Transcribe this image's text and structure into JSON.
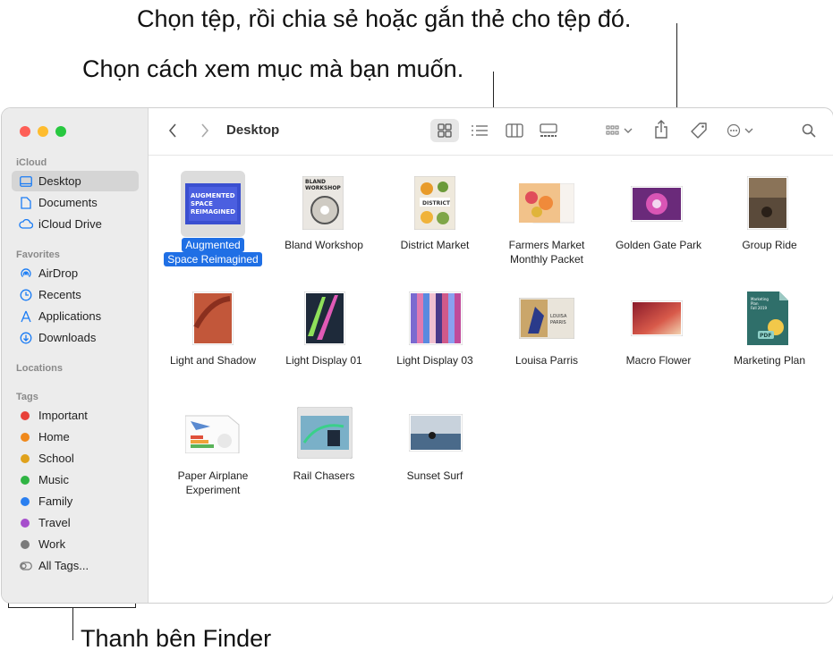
{
  "callouts": {
    "top_share_tag": "Chọn tệp, rồi chia sẻ hoặc gắn thẻ cho tệp đó.",
    "top_view": "Chọn cách xem mục mà bạn muốn.",
    "bottom_sidebar": "Thanh bên Finder"
  },
  "window": {
    "title": "Desktop"
  },
  "sidebar": {
    "sections": {
      "icloud": "iCloud",
      "favorites": "Favorites",
      "locations": "Locations",
      "tags": "Tags"
    },
    "icloud_items": [
      {
        "label": "Desktop",
        "icon": "desktop-icon"
      },
      {
        "label": "Documents",
        "icon": "document-icon"
      },
      {
        "label": "iCloud Drive",
        "icon": "cloud-icon"
      }
    ],
    "favorite_items": [
      {
        "label": "AirDrop",
        "icon": "airdrop-icon"
      },
      {
        "label": "Recents",
        "icon": "clock-icon"
      },
      {
        "label": "Applications",
        "icon": "applications-icon"
      },
      {
        "label": "Downloads",
        "icon": "download-icon"
      }
    ],
    "tag_items": [
      {
        "label": "Important",
        "color": "#e8413a"
      },
      {
        "label": "Home",
        "color": "#f0891b"
      },
      {
        "label": "School",
        "color": "#e0a21c"
      },
      {
        "label": "Music",
        "color": "#2fb443"
      },
      {
        "label": "Family",
        "color": "#2a7ff0"
      },
      {
        "label": "Travel",
        "color": "#a64fcc"
      },
      {
        "label": "Work",
        "color": "#7b7b7b"
      }
    ],
    "all_tags": "All Tags..."
  },
  "files": [
    {
      "line1": "Augmented",
      "line2": "Space Reimagined",
      "selected": true
    },
    {
      "line1": "Bland Workshop",
      "line2": ""
    },
    {
      "line1": "District Market",
      "line2": ""
    },
    {
      "line1": "Farmers Market",
      "line2": "Monthly Packet"
    },
    {
      "line1": "Golden Gate Park",
      "line2": ""
    },
    {
      "line1": "Group Ride",
      "line2": ""
    },
    {
      "line1": "Light and Shadow",
      "line2": ""
    },
    {
      "line1": "Light Display 01",
      "line2": ""
    },
    {
      "line1": "Light Display 03",
      "line2": ""
    },
    {
      "line1": "Louisa Parris",
      "line2": ""
    },
    {
      "line1": "Macro Flower",
      "line2": ""
    },
    {
      "line1": "Marketing Plan",
      "line2": ""
    },
    {
      "line1": "Paper Airplane",
      "line2": "Experiment"
    },
    {
      "line1": "Rail Chasers",
      "line2": ""
    },
    {
      "line1": "Sunset Surf",
      "line2": ""
    }
  ],
  "thumb_text": {
    "augmented": "AUGMENTED SPACE REIMAGINED",
    "bland": "BLAND WORKSHOP",
    "district": "DISTRICT",
    "louisa": "LOUISA PARRIS",
    "marketing": "Marketing Plan Fall 2019",
    "marketing_badge": "PDF"
  },
  "colors": {
    "accent": "#1f6fe5",
    "sidebar_bg": "#ececec"
  }
}
